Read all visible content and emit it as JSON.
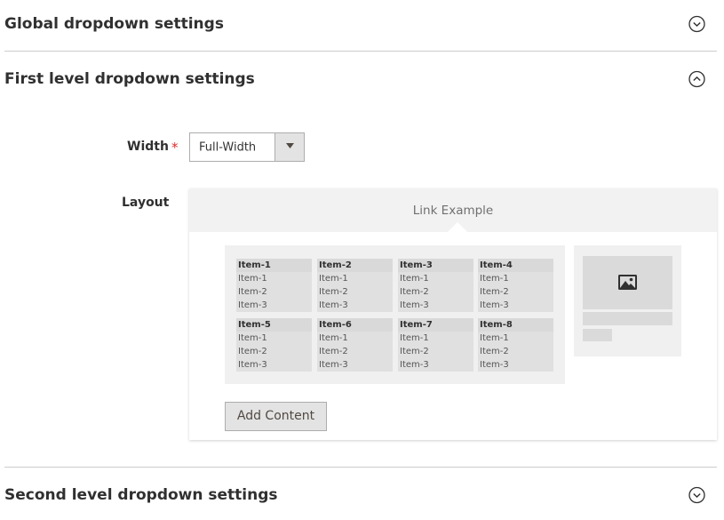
{
  "sections": {
    "global": {
      "title": "Global dropdown settings",
      "state": "collapsed"
    },
    "first": {
      "title": "First level dropdown settings",
      "state": "expanded"
    },
    "second": {
      "title": "Second level dropdown settings",
      "state": "collapsed"
    }
  },
  "width_field": {
    "label": "Width",
    "required_mark": "*",
    "value": "Full-Width"
  },
  "layout_field": {
    "label": "Layout",
    "link_example": "Link Example",
    "columns": [
      {
        "header": "Item-1",
        "items": [
          "Item-1",
          "Item-2",
          "Item-3"
        ]
      },
      {
        "header": "Item-2",
        "items": [
          "Item-1",
          "Item-2",
          "Item-3"
        ]
      },
      {
        "header": "Item-3",
        "items": [
          "Item-1",
          "Item-2",
          "Item-3"
        ]
      },
      {
        "header": "Item-4",
        "items": [
          "Item-1",
          "Item-2",
          "Item-3"
        ]
      },
      {
        "header": "Item-5",
        "items": [
          "Item-1",
          "Item-2",
          "Item-3"
        ]
      },
      {
        "header": "Item-6",
        "items": [
          "Item-1",
          "Item-2",
          "Item-3"
        ]
      },
      {
        "header": "Item-7",
        "items": [
          "Item-1",
          "Item-2",
          "Item-3"
        ]
      },
      {
        "header": "Item-8",
        "items": [
          "Item-1",
          "Item-2",
          "Item-3"
        ]
      }
    ],
    "image_icon": "image-icon",
    "add_content_label": "Add Content"
  },
  "icons": {
    "collapsed": "chevron-down-circle-icon",
    "expanded": "chevron-up-circle-icon",
    "select_arrow": "triangle-down-icon"
  },
  "colors": {
    "required": "#e02b27",
    "panel_bg": "#f2f2f2",
    "button_bg": "#e3e3e3"
  }
}
